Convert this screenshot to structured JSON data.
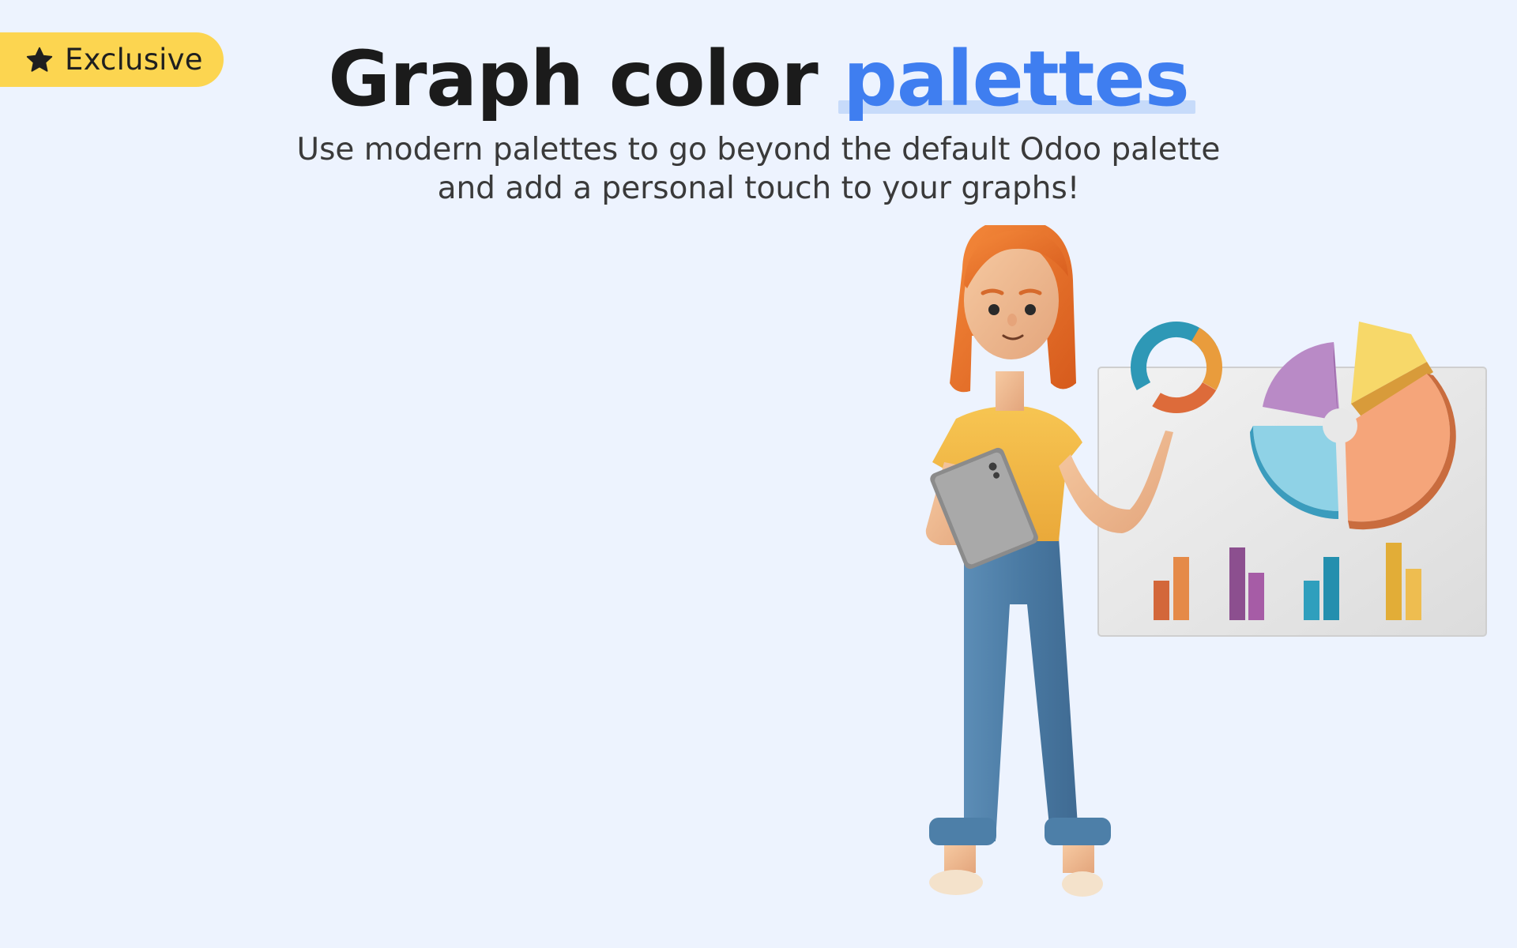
{
  "badge": {
    "icon": "star-icon",
    "label": "Exclusive",
    "color": "#fcd550"
  },
  "title": {
    "main": "Graph color ",
    "accent": "palettes",
    "accent_color": "#3f7ef0"
  },
  "subtitle": {
    "line1": "Use modern palettes to go beyond the default Odoo palette",
    "line2": "and add a personal touch to your graphs!"
  },
  "illustration": {
    "subject": "woman-with-tablet-presenting-charts"
  }
}
